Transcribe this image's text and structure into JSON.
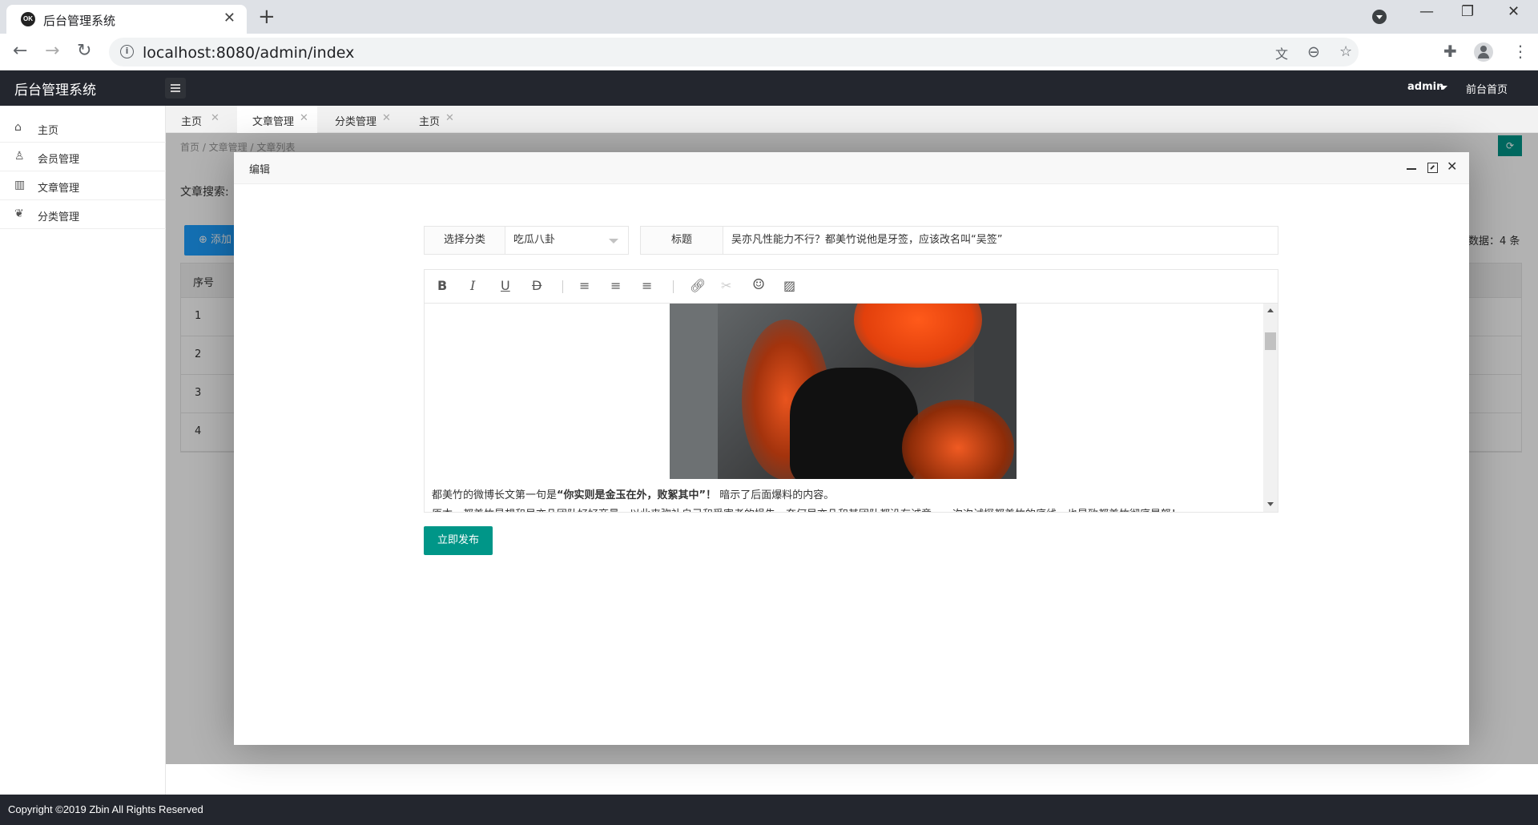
{
  "browser": {
    "tab_title": "后台管理系统",
    "favicon_text": "OK",
    "url": "localhost:8080/admin/index"
  },
  "header": {
    "logo": "后台管理系统",
    "user": "admin",
    "front_link": "前台首页"
  },
  "sidebar": {
    "items": [
      {
        "label": "主页",
        "icon": "home-icon"
      },
      {
        "label": "会员管理",
        "icon": "user-icon"
      },
      {
        "label": "文章管理",
        "icon": "book-icon"
      },
      {
        "label": "分类管理",
        "icon": "category-icon"
      }
    ]
  },
  "page_tabs": [
    {
      "label": "主页",
      "active": false
    },
    {
      "label": "文章管理",
      "active": true
    },
    {
      "label": "分类管理",
      "active": false
    },
    {
      "label": "主页",
      "active": false
    }
  ],
  "page": {
    "breadcrumb": "首页 / 文章管理 / 文章列表",
    "search_label": "文章搜索:",
    "add_button": "添加",
    "total": "数据：4 条",
    "refresh_icon": "refresh-icon",
    "table": {
      "header": "序号",
      "rows": [
        "1",
        "2",
        "3",
        "4"
      ]
    }
  },
  "modal": {
    "title": "编辑",
    "category_label": "选择分类",
    "category_value": "吃瓜八卦",
    "title_label": "标题",
    "title_value": "吴亦凡性能力不行？都美竹说他是牙签，应该改名叫“吴签”",
    "editor_text_prefix": "都美竹的微博长文第一句是",
    "editor_text_bold": "“你实则是金玉在外，败絮其中”！",
    "editor_text_suffix": "暗示了后面爆料的内容。",
    "editor_text_line2": "原本，都美竹是想和吴亦凡团队好好商量，以此来弥补自己和受害者的损失，奈何吴亦凡和其团队都没有诚意，一次次试探都美竹的底线，也是致都美竹彻底暴怒！",
    "publish_button": "立即发布"
  },
  "footer": {
    "copyright": "Copyright ©2019 Zbin All Rights Reserved"
  },
  "colors": {
    "accent": "#009688",
    "header_bg": "#23262e",
    "add_button": "#1E9FFF"
  }
}
